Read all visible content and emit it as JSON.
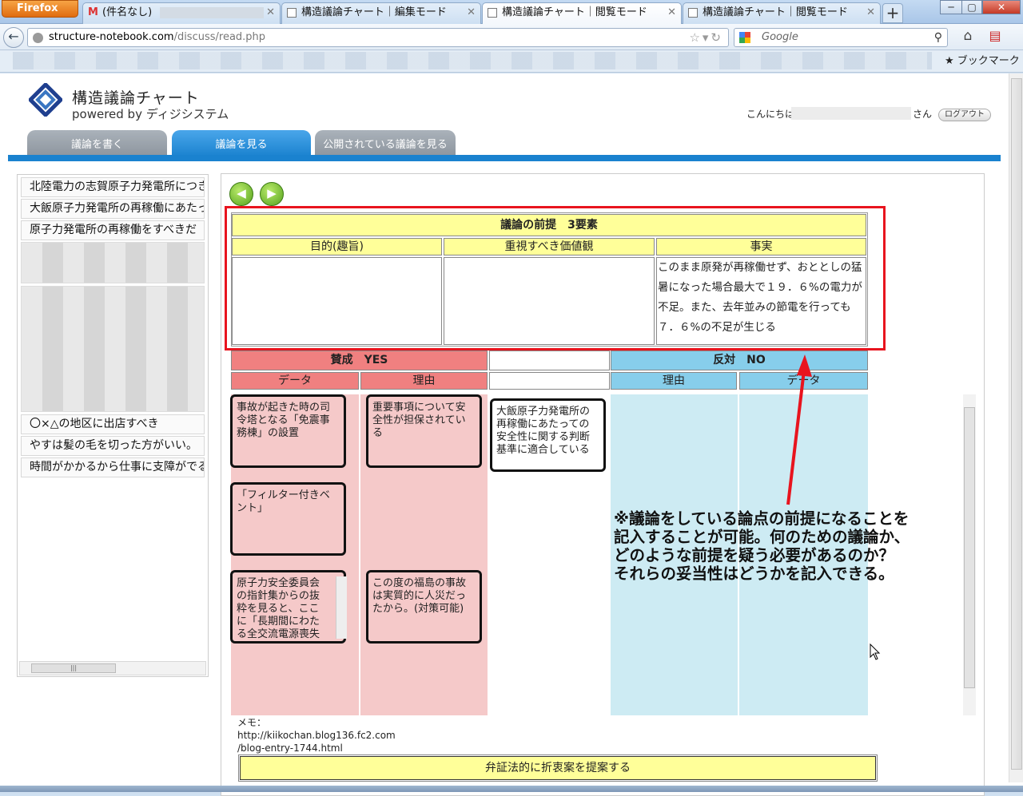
{
  "browser": {
    "menu_label": "Firefox",
    "tabs": [
      {
        "label": "(件名なし)"
      },
      {
        "label": "構造議論チャート｜編集モード"
      },
      {
        "label": "構造議論チャート｜閲覧モード"
      },
      {
        "label": "構造議論チャート｜閲覧モード"
      }
    ],
    "url_host": "structure-notebook.com",
    "url_path": "/discuss/read.php",
    "search_placeholder": "Google",
    "bookmarks_label": "ブックマーク"
  },
  "site": {
    "title": "構造議論チャート",
    "subtitle": "powered by ディジシステム",
    "greeting": "こんにちは",
    "greeting_suffix": "さん",
    "logout_label": "ログアウト",
    "nav": [
      {
        "label": "議論を書く"
      },
      {
        "label": "議論を見る"
      },
      {
        "label": "公開されている議論を見る"
      }
    ]
  },
  "sidebar": {
    "items": [
      {
        "label": "北陸電力の志賀原子力発電所につき"
      },
      {
        "label": "大飯原子力発電所の再稼働にあたって"
      },
      {
        "label": "原子力発電所の再稼働をすべきだ"
      },
      {
        "label": "〇×△の地区に出店すべき"
      },
      {
        "label": "やすは髪の毛を切った方がいい。"
      },
      {
        "label": "時間がかかるから仕事に支障がでる"
      }
    ]
  },
  "premise": {
    "title": "議論の前提　3要素",
    "columns": [
      "目的(趣旨)",
      "重視すべき価値観",
      "事実"
    ],
    "values": [
      "",
      "",
      "このまま原発が再稼働せず、おととしの猛暑になった場合最大で１９．６%の電力が不足。また、去年並みの節電を行っても７．６%の不足が生じる"
    ]
  },
  "chart": {
    "yes_label": "賛成　YES",
    "no_label": "反対　NO",
    "yes_cols": [
      "データ",
      "理由"
    ],
    "no_cols": [
      "理由",
      "データ"
    ],
    "yes_data_cards": [
      "事故が起きた時の司令塔となる「免震事務棟」の設置",
      "「フィルター付きベント」",
      "原子力安全委員会の指針集からの抜粋を見ると、ここに「長期間にわたる全交流電源喪失は、送電の"
    ],
    "yes_reason_cards": [
      "重要事項について安全性が担保されている",
      "この度の福島の事故は実質的に人災だったから。(対策可能)"
    ],
    "claim_card": "大飯原子力発電所の再稼働にあたっての安全性に関する判断基準に適合している"
  },
  "annotation": {
    "lines": [
      "※議論をしている論点の前提になることを",
      "記入することが可能。何のための議論か、",
      "どのような前提を疑う必要があるのか？",
      "それらの妥当性はどうかを記入できる。"
    ],
    "color": "#e8141e"
  },
  "memo": {
    "label": "メモ：",
    "lines": [
      "http://kiikochan.blog136.fc2.com",
      "/blog-entry-1744.html"
    ]
  },
  "propose_button": "弁証法的に折衷案を提案する",
  "colors": {
    "yes_header": "#f08080",
    "no_header": "#87ceeb",
    "premise_yellow": "#ffff99",
    "accent_blue": "#1a82cf"
  }
}
